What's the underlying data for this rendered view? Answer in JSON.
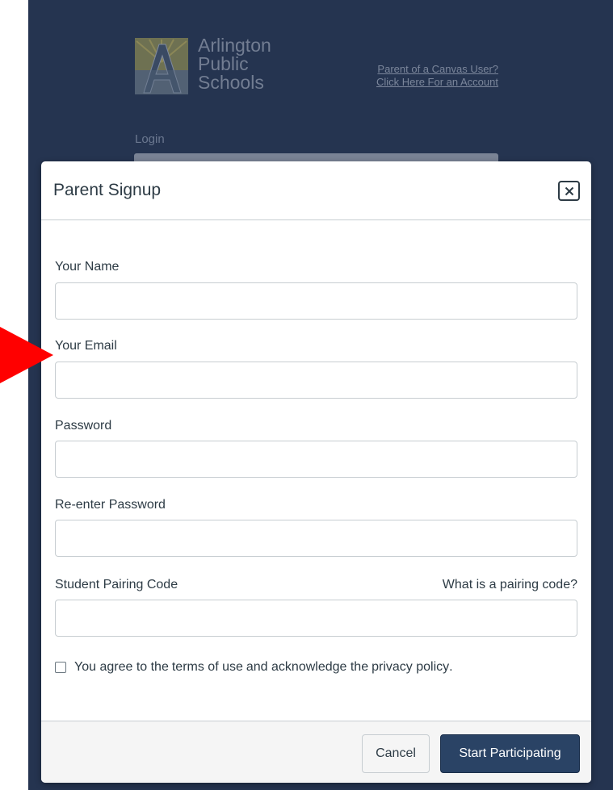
{
  "login_page": {
    "logo": {
      "line1": "Arlington",
      "line2": "Public",
      "line3": "Schools",
      "mark_letter": "A"
    },
    "parent_link_line1": "Parent of a Canvas User?",
    "parent_link_line2": "Click Here For an Account",
    "login_label": "Login"
  },
  "modal": {
    "title": "Parent Signup",
    "close_icon": "close-icon",
    "fields": {
      "name": {
        "label": "Your Name",
        "value": ""
      },
      "email": {
        "label": "Your Email",
        "value": ""
      },
      "password": {
        "label": "Password",
        "value": ""
      },
      "reenter_password": {
        "label": "Re-enter Password",
        "value": ""
      },
      "pairing_code": {
        "label": "Student Pairing Code",
        "value": ""
      }
    },
    "pairing_help_link": "What is a pairing code?",
    "agreement": {
      "prefix": "You agree to the",
      "terms_link": "terms of use",
      "middle": "and acknowledge the",
      "privacy_link": "privacy policy",
      "suffix": ".",
      "checked": false
    },
    "footer": {
      "cancel_label": "Cancel",
      "submit_label": "Start Participating"
    }
  },
  "annotation": {
    "arrow_icon": "red-arrow-icon",
    "color": "#ff0000"
  },
  "colors": {
    "backdrop": "#253450",
    "primary_button": "#2a4365",
    "text": "#2d3b45"
  }
}
